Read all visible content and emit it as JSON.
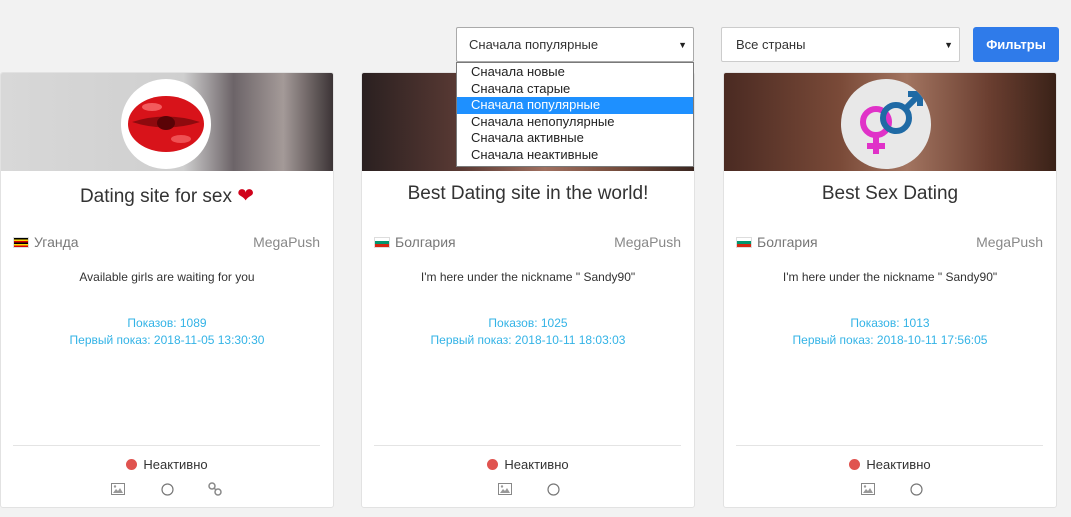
{
  "toolbar": {
    "sort_value": "Сначала популярные",
    "country_value": "Все страны",
    "filters_label": "Фильтры"
  },
  "sort_options": [
    "Сначала новые",
    "Сначала старые",
    "Сначала популярные",
    "Сначала непопулярные",
    "Сначала активные",
    "Сначала неактивные"
  ],
  "cards": [
    {
      "title": "Dating site for sex",
      "country": "Уганда",
      "network": "MegaPush",
      "description": "Available girls are waiting for you",
      "impressions": "Показов: 1089",
      "first_shown": "Первый показ: 2018-11-05 13:30:30",
      "status": "Неактивно",
      "icon": "lips-icon"
    },
    {
      "title": "Best Dating site in the world!",
      "country": "Болгария",
      "network": "MegaPush",
      "description": "I'm here under the nickname \" Sandy90\"",
      "impressions": "Показов: 1025",
      "first_shown": "Первый показ: 2018-10-11 18:03:03",
      "status": "Неактивно",
      "icon": "none"
    },
    {
      "title": "Best Sex Dating",
      "country": "Болгария",
      "network": "MegaPush",
      "description": "I'm here under the nickname \" Sandy90\"",
      "impressions": "Показов: 1013",
      "first_shown": "Первый показ: 2018-10-11 17:56:05",
      "status": "Неактивно",
      "icon": "gender-symbols-icon"
    }
  ],
  "colors": {
    "accent": "#2f7bea",
    "selected": "#1e90ff",
    "stats": "#33b3e6",
    "inactive": "#e0534f"
  }
}
